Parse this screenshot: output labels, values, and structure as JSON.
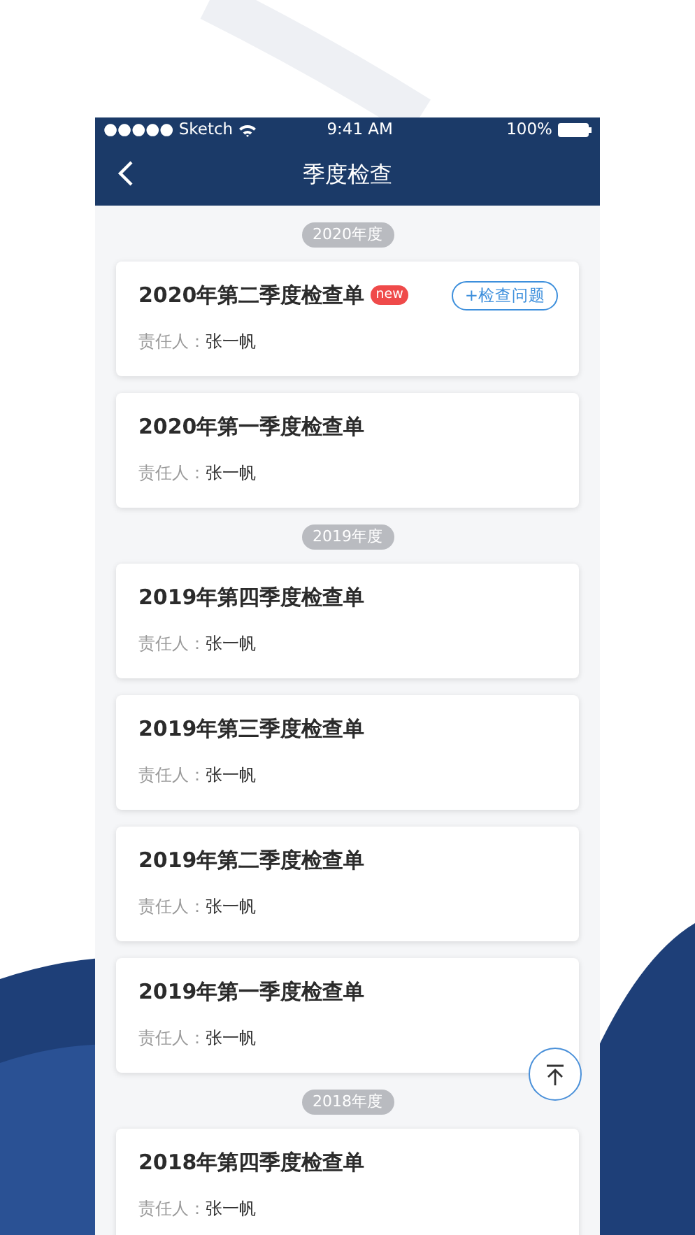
{
  "status_bar": {
    "carrier": "●●●●● Sketch",
    "time": "9:41 AM",
    "battery": "100%"
  },
  "nav_bar": {
    "title": "季度检查"
  },
  "sections": [
    {
      "year": "2020年度",
      "cards": [
        {
          "title": "2020年第二季度检查单",
          "badge": "new",
          "action": "+检查问题",
          "person_label": "责任人：",
          "person": "张一帆"
        },
        {
          "title": "2020年第一季度检查单",
          "person_label": "责任人：",
          "person": "张一帆"
        }
      ]
    },
    {
      "year": "2019年度",
      "cards": [
        {
          "title": "2019年第四季度检查单",
          "person_label": "责任人：",
          "person": "张一帆"
        },
        {
          "title": "2019年第三季度检查单",
          "person_label": "责任人：",
          "person": "张一帆"
        },
        {
          "title": "2019年第二季度检查单",
          "person_label": "责任人：",
          "person": "张一帆"
        },
        {
          "title": "2019年第一季度检查单",
          "person_label": "责任人：",
          "person": "张一帆"
        }
      ]
    },
    {
      "year": "2018年度",
      "cards": [
        {
          "title": "2018年第四季度检查单",
          "person_label": "责任人：",
          "person": "张一帆"
        }
      ]
    }
  ]
}
